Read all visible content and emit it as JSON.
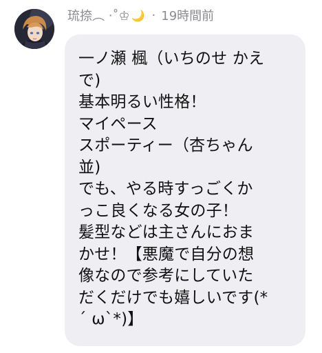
{
  "message": {
    "author": "琉捺︵ ‧˚♔",
    "author_moon_emoji": "🌙",
    "separator": "·",
    "timestamp": "19時間前",
    "lines": [
      "一ノ瀬 楓（いちのせ かえ",
      "で)",
      "基本明るい性格！",
      "マイペース",
      "スポーティー（杏ちゃん",
      "並)",
      "でも、やる時すっごくか",
      "っこ良くなる女の子！",
      "髪型などは主さんにおま",
      "かせ！【悪魔で自分の想",
      "像なので参考にしていた",
      "だくだけでも嬉しいです(*",
      "´ ω`*)】"
    ]
  },
  "colors": {
    "bubble_background": "#efeff3",
    "meta_text": "#8a8a8f",
    "body_text": "#111111",
    "moon": "#f2b705"
  },
  "icons": {
    "avatar": "user-avatar-anime-portrait"
  }
}
